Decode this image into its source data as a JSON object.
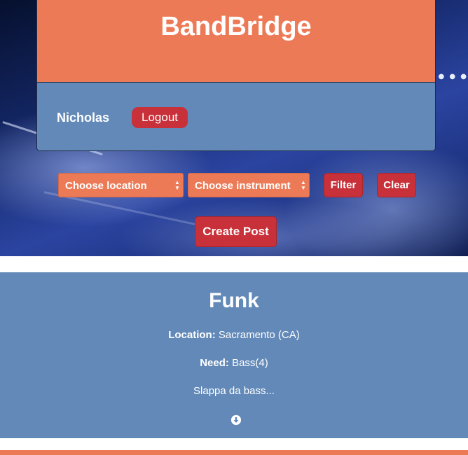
{
  "header": {
    "brand": "BandBridge",
    "username": "Nicholas",
    "logout_label": "Logout"
  },
  "filters": {
    "location_select": "Choose location",
    "instrument_select": "Choose instrument",
    "filter_label": "Filter",
    "clear_label": "Clear"
  },
  "actions": {
    "create_post_label": "Create Post"
  },
  "posts": [
    {
      "title": "Funk",
      "location_label": "Location:",
      "location_value": "Sacramento (CA)",
      "need_label": "Need:",
      "need_value": "Bass(4)",
      "description": "Slappa da bass..."
    }
  ],
  "colors": {
    "brand_orange": "#ec7a56",
    "panel_blue": "#6289b8",
    "button_red": "#c9313a"
  },
  "icons": {
    "expand": "arrow-down-circle-icon",
    "select_arrows": "updown-arrows-icon"
  }
}
